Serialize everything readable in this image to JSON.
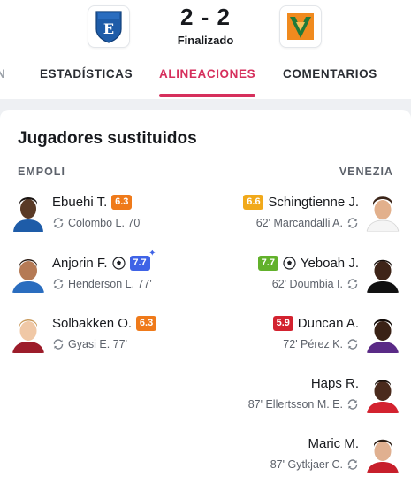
{
  "match": {
    "home_crest": "empoli-crest-icon",
    "away_crest": "venezia-crest-icon",
    "score": "2 - 2",
    "status": "Finalizado"
  },
  "tabs": [
    {
      "label": "N",
      "icon": ""
    },
    {
      "label": "ESTADÍSTICAS"
    },
    {
      "label": "ALINEACIONES",
      "active": true
    },
    {
      "label": "COMENTARIOS"
    }
  ],
  "section": {
    "title": "Jugadores sustituidos",
    "home_team": "EMPOLI",
    "away_team": "VENEZIA"
  },
  "home_players": [
    {
      "name": "Ebuehi T.",
      "rating": "6.3",
      "rating_color": "#ef7a1a",
      "replaced": "Colombo L. 70'"
    },
    {
      "name": "Anjorin F.",
      "rating": "7.7",
      "rating_color": "#3f63e6",
      "goal": true,
      "star": true,
      "replaced": "Henderson L. 77'"
    },
    {
      "name": "Solbakken O.",
      "rating": "6.3",
      "rating_color": "#ef7a1a",
      "replaced": "Gyasi E. 77'"
    }
  ],
  "away_players": [
    {
      "name": "Schingtienne J.",
      "rating": "6.6",
      "rating_color": "#f1a91a",
      "replaced": "62' Marcandalli A."
    },
    {
      "name": "Yeboah J.",
      "rating": "7.7",
      "rating_color": "#62b12b",
      "goal": true,
      "replaced": "62' Doumbia I."
    },
    {
      "name": "Duncan A.",
      "rating": "5.9",
      "rating_color": "#d3222f",
      "replaced": "72' Pérez K."
    },
    {
      "name": "Haps R.",
      "rating": "",
      "replaced": "87' Ellertsson M. E."
    },
    {
      "name": "Maric M.",
      "rating": "",
      "replaced": "87' Gytkjaer C."
    }
  ],
  "colors": {
    "accent": "#d62f5c",
    "background": "#eef0f3"
  }
}
